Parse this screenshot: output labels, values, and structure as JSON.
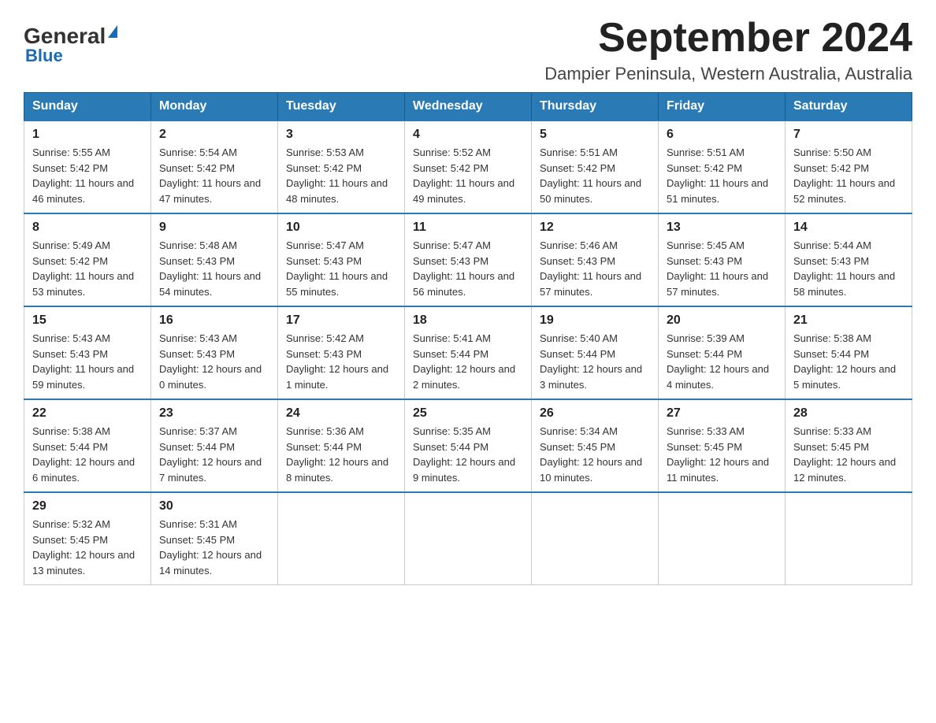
{
  "header": {
    "logo_general": "General",
    "logo_blue": "Blue",
    "month_title": "September 2024",
    "location": "Dampier Peninsula, Western Australia, Australia"
  },
  "weekdays": [
    "Sunday",
    "Monday",
    "Tuesday",
    "Wednesday",
    "Thursday",
    "Friday",
    "Saturday"
  ],
  "weeks": [
    [
      {
        "day": "1",
        "sunrise": "5:55 AM",
        "sunset": "5:42 PM",
        "daylight": "11 hours and 46 minutes."
      },
      {
        "day": "2",
        "sunrise": "5:54 AM",
        "sunset": "5:42 PM",
        "daylight": "11 hours and 47 minutes."
      },
      {
        "day": "3",
        "sunrise": "5:53 AM",
        "sunset": "5:42 PM",
        "daylight": "11 hours and 48 minutes."
      },
      {
        "day": "4",
        "sunrise": "5:52 AM",
        "sunset": "5:42 PM",
        "daylight": "11 hours and 49 minutes."
      },
      {
        "day": "5",
        "sunrise": "5:51 AM",
        "sunset": "5:42 PM",
        "daylight": "11 hours and 50 minutes."
      },
      {
        "day": "6",
        "sunrise": "5:51 AM",
        "sunset": "5:42 PM",
        "daylight": "11 hours and 51 minutes."
      },
      {
        "day": "7",
        "sunrise": "5:50 AM",
        "sunset": "5:42 PM",
        "daylight": "11 hours and 52 minutes."
      }
    ],
    [
      {
        "day": "8",
        "sunrise": "5:49 AM",
        "sunset": "5:42 PM",
        "daylight": "11 hours and 53 minutes."
      },
      {
        "day": "9",
        "sunrise": "5:48 AM",
        "sunset": "5:43 PM",
        "daylight": "11 hours and 54 minutes."
      },
      {
        "day": "10",
        "sunrise": "5:47 AM",
        "sunset": "5:43 PM",
        "daylight": "11 hours and 55 minutes."
      },
      {
        "day": "11",
        "sunrise": "5:47 AM",
        "sunset": "5:43 PM",
        "daylight": "11 hours and 56 minutes."
      },
      {
        "day": "12",
        "sunrise": "5:46 AM",
        "sunset": "5:43 PM",
        "daylight": "11 hours and 57 minutes."
      },
      {
        "day": "13",
        "sunrise": "5:45 AM",
        "sunset": "5:43 PM",
        "daylight": "11 hours and 57 minutes."
      },
      {
        "day": "14",
        "sunrise": "5:44 AM",
        "sunset": "5:43 PM",
        "daylight": "11 hours and 58 minutes."
      }
    ],
    [
      {
        "day": "15",
        "sunrise": "5:43 AM",
        "sunset": "5:43 PM",
        "daylight": "11 hours and 59 minutes."
      },
      {
        "day": "16",
        "sunrise": "5:43 AM",
        "sunset": "5:43 PM",
        "daylight": "12 hours and 0 minutes."
      },
      {
        "day": "17",
        "sunrise": "5:42 AM",
        "sunset": "5:43 PM",
        "daylight": "12 hours and 1 minute."
      },
      {
        "day": "18",
        "sunrise": "5:41 AM",
        "sunset": "5:44 PM",
        "daylight": "12 hours and 2 minutes."
      },
      {
        "day": "19",
        "sunrise": "5:40 AM",
        "sunset": "5:44 PM",
        "daylight": "12 hours and 3 minutes."
      },
      {
        "day": "20",
        "sunrise": "5:39 AM",
        "sunset": "5:44 PM",
        "daylight": "12 hours and 4 minutes."
      },
      {
        "day": "21",
        "sunrise": "5:38 AM",
        "sunset": "5:44 PM",
        "daylight": "12 hours and 5 minutes."
      }
    ],
    [
      {
        "day": "22",
        "sunrise": "5:38 AM",
        "sunset": "5:44 PM",
        "daylight": "12 hours and 6 minutes."
      },
      {
        "day": "23",
        "sunrise": "5:37 AM",
        "sunset": "5:44 PM",
        "daylight": "12 hours and 7 minutes."
      },
      {
        "day": "24",
        "sunrise": "5:36 AM",
        "sunset": "5:44 PM",
        "daylight": "12 hours and 8 minutes."
      },
      {
        "day": "25",
        "sunrise": "5:35 AM",
        "sunset": "5:44 PM",
        "daylight": "12 hours and 9 minutes."
      },
      {
        "day": "26",
        "sunrise": "5:34 AM",
        "sunset": "5:45 PM",
        "daylight": "12 hours and 10 minutes."
      },
      {
        "day": "27",
        "sunrise": "5:33 AM",
        "sunset": "5:45 PM",
        "daylight": "12 hours and 11 minutes."
      },
      {
        "day": "28",
        "sunrise": "5:33 AM",
        "sunset": "5:45 PM",
        "daylight": "12 hours and 12 minutes."
      }
    ],
    [
      {
        "day": "29",
        "sunrise": "5:32 AM",
        "sunset": "5:45 PM",
        "daylight": "12 hours and 13 minutes."
      },
      {
        "day": "30",
        "sunrise": "5:31 AM",
        "sunset": "5:45 PM",
        "daylight": "12 hours and 14 minutes."
      },
      null,
      null,
      null,
      null,
      null
    ]
  ],
  "labels": {
    "sunrise": "Sunrise: ",
    "sunset": "Sunset: ",
    "daylight": "Daylight: "
  }
}
